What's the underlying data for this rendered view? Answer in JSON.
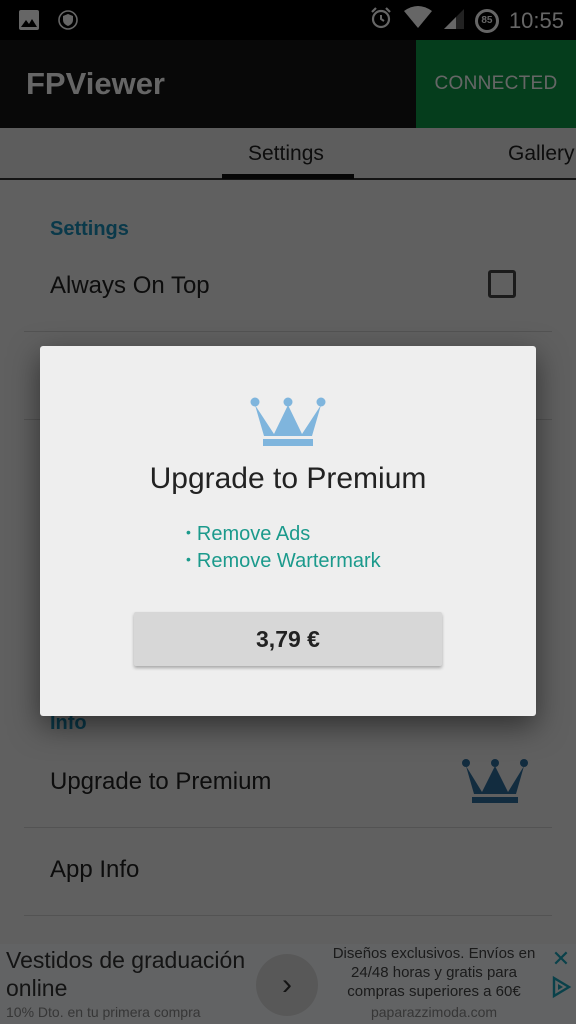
{
  "status_bar": {
    "time": "10:55",
    "battery_level": "85",
    "icons": [
      "image-icon",
      "shield-icon",
      "alarm-icon",
      "wifi-icon",
      "signal-icon",
      "battery-icon"
    ]
  },
  "app_bar": {
    "title": "FPViewer",
    "status_button": "CONNECTED",
    "status_color": "#0d9a48"
  },
  "tabs": [
    {
      "label": "Settings",
      "selected": true
    },
    {
      "label": "Gallery",
      "selected": false
    }
  ],
  "settings": {
    "section_header": "Settings",
    "items": [
      {
        "label": "Always On Top",
        "checked": false
      }
    ]
  },
  "info": {
    "section_header": "Info",
    "items": [
      {
        "label": "Upgrade to Premium",
        "icon": "crown-icon"
      },
      {
        "label": "App Info"
      }
    ]
  },
  "dialog": {
    "icon": "crown-icon",
    "title": "Upgrade to Premium",
    "benefits": [
      "Remove Ads",
      "Remove Wartermark"
    ],
    "price_button": "3,79 €",
    "accent_color": "#1b9a8c",
    "crown_color": "#7fb5dd"
  },
  "ad": {
    "title": "Vestidos de graduación online",
    "subtitle": "10% Dto. en tu primera compra",
    "description": "Diseños exclusivos. Envíos en 24/48 horas y gratis para compras superiores a 60€",
    "domain": "paparazzimoda.com",
    "arrow": "›",
    "close": "✕"
  }
}
